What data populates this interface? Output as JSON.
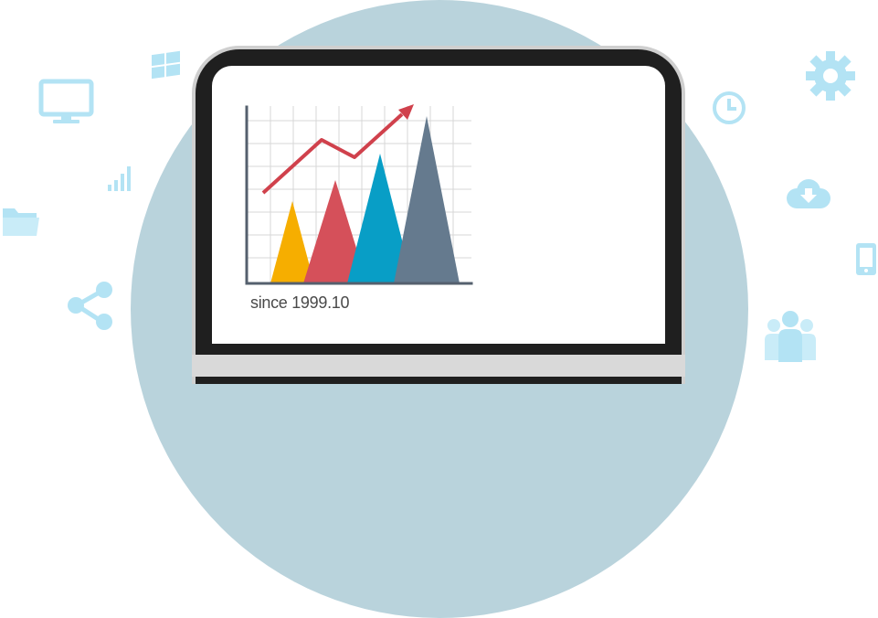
{
  "caption": "since 1999.10",
  "icons": [
    "windows-logo-icon",
    "monitor-icon",
    "signal-bars-icon",
    "folder-icon",
    "share-icon",
    "clock-icon",
    "gear-icon",
    "cloud-download-icon",
    "mobile-phone-icon",
    "users-icon"
  ],
  "colors": {
    "background_circle": "#b9d3dc",
    "icon": "#b3e3f4",
    "trend_arrow": "#d0414c",
    "triangle_yellow": "#f6ae00",
    "triangle_red": "#d5505a",
    "triangle_blue": "#089ec6",
    "triangle_slate": "#657a8e"
  }
}
